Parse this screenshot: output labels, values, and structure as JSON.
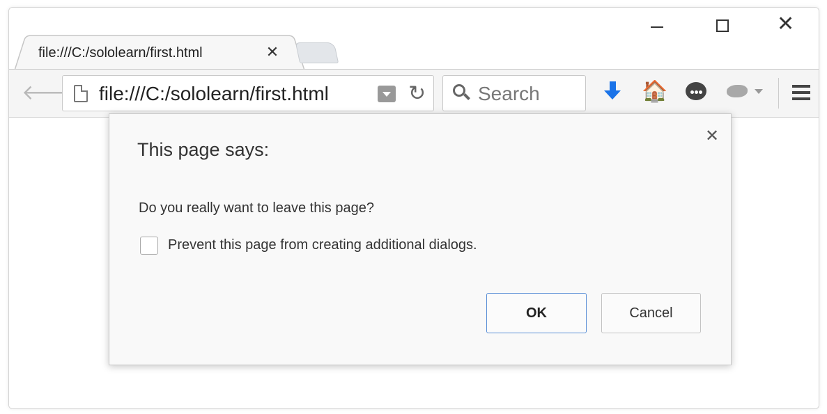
{
  "tabs": [
    {
      "title": "file:///C:/sololearn/first.html",
      "close_glyph": "✕",
      "active": true
    }
  ],
  "window_controls": {
    "minimize_icon": "minimize-icon",
    "maximize_icon": "maximize-icon",
    "close_glyph": "✕"
  },
  "toolbar": {
    "url": "file:///C:/sololearn/first.html",
    "search_placeholder": "Search",
    "back_glyph": "🡐",
    "reload_glyph": "↻",
    "home_glyph": "🏠",
    "accent_color": "#1a73e8"
  },
  "dialog": {
    "title": "This page says:",
    "close_glyph": "✕",
    "message": "Do you really want to leave this page?",
    "checkbox_label": "Prevent this page from creating additional dialogs.",
    "checkbox_checked": false,
    "ok_label": "OK",
    "cancel_label": "Cancel"
  }
}
